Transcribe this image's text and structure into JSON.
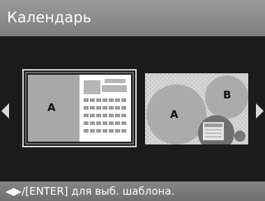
{
  "header": {
    "title": "Календарь"
  },
  "templates": [
    {
      "letter_a": "A"
    },
    {
      "letter_a": "A",
      "letter_b": "B"
    }
  ],
  "icons": {
    "left": "arrow-left-icon",
    "right": "arrow-right-icon"
  },
  "footer": {
    "hint": "◀▶/[ENTER] для выб. шаблона."
  }
}
